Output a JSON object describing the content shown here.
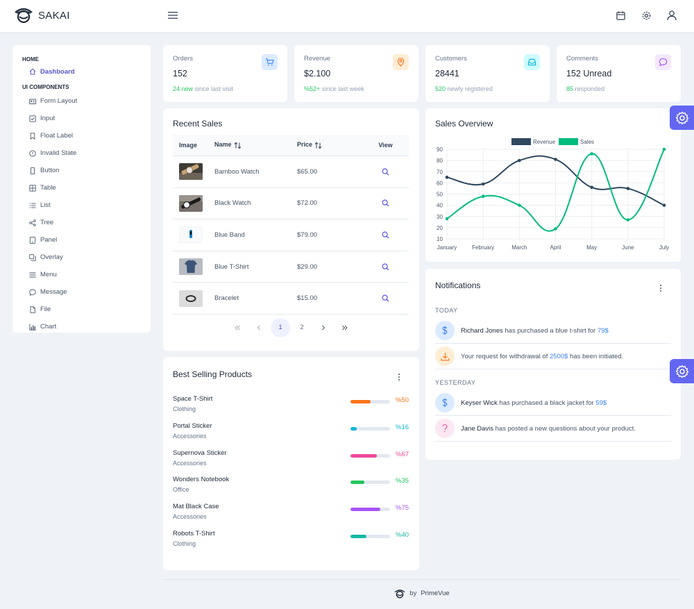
{
  "app": {
    "name": "SAKAI"
  },
  "sidebar": {
    "sections": [
      {
        "label": "HOME",
        "items": [
          {
            "label": "Dashboard",
            "icon": "home-icon",
            "active": true
          }
        ]
      },
      {
        "label": "UI COMPONENTS",
        "items": [
          {
            "label": "Form Layout",
            "icon": "id-card-icon"
          },
          {
            "label": "Input",
            "icon": "check-square-icon"
          },
          {
            "label": "Float Label",
            "icon": "bookmark-icon"
          },
          {
            "label": "Invalid State",
            "icon": "exclamation-circle-icon"
          },
          {
            "label": "Button",
            "icon": "mobile-icon"
          },
          {
            "label": "Table",
            "icon": "table-icon"
          },
          {
            "label": "List",
            "icon": "list-icon"
          },
          {
            "label": "Tree",
            "icon": "share-alt-icon"
          },
          {
            "label": "Panel",
            "icon": "tablet-icon"
          },
          {
            "label": "Overlay",
            "icon": "clone-icon"
          },
          {
            "label": "Menu",
            "icon": "bars-icon"
          },
          {
            "label": "Message",
            "icon": "comment-icon"
          },
          {
            "label": "File",
            "icon": "file-icon"
          },
          {
            "label": "Chart",
            "icon": "chart-bar-icon"
          }
        ]
      }
    ]
  },
  "stats": [
    {
      "label": "Orders",
      "value": "152",
      "highlight": "24 new",
      "rest": " since last visit",
      "icon": "shopping-cart-icon",
      "bg": "#dbeafe",
      "fg": "#3b82f6"
    },
    {
      "label": "Revenue",
      "value": "$2.100",
      "highlight": "%52+",
      "rest": " since last week",
      "icon": "map-marker-icon",
      "bg": "#ffedd5",
      "fg": "#f97316"
    },
    {
      "label": "Customers",
      "value": "28441",
      "highlight": "520",
      "rest": " newly registered",
      "icon": "inbox-icon",
      "bg": "#cffafe",
      "fg": "#06b6d4"
    },
    {
      "label": "Comments",
      "value": "152 Unread",
      "highlight": "85",
      "rest": " responded",
      "icon": "comment-icon",
      "bg": "#f3e8ff",
      "fg": "#a855f7"
    }
  ],
  "recent_sales": {
    "title": "Recent Sales",
    "columns": {
      "image": "Image",
      "name": "Name",
      "price": "Price",
      "view": "View"
    },
    "rows": [
      {
        "name": "Bamboo Watch",
        "price": "$65.00",
        "thumb": "bamboo-watch"
      },
      {
        "name": "Black Watch",
        "price": "$72.00",
        "thumb": "black-watch"
      },
      {
        "name": "Blue Band",
        "price": "$79.00",
        "thumb": "blue-band"
      },
      {
        "name": "Blue T-Shirt",
        "price": "$29.00",
        "thumb": "blue-t-shirt"
      },
      {
        "name": "Bracelet",
        "price": "$15.00",
        "thumb": "bracelet"
      }
    ],
    "pagination": {
      "pages": [
        "1",
        "2"
      ],
      "current": "1"
    }
  },
  "best_selling": {
    "title": "Best Selling Products",
    "items": [
      {
        "name": "Space T-Shirt",
        "category": "Clothing",
        "percent": 50,
        "label": "%50",
        "color": "#f97316"
      },
      {
        "name": "Portal Sticker",
        "category": "Accessories",
        "percent": 16,
        "label": "%16",
        "color": "#06b6d4"
      },
      {
        "name": "Supernova Sticker",
        "category": "Accessories",
        "percent": 67,
        "label": "%67",
        "color": "#ec4899"
      },
      {
        "name": "Wonders Notebook",
        "category": "Office",
        "percent": 35,
        "label": "%35",
        "color": "#22c55e"
      },
      {
        "name": "Mat Black Case",
        "category": "Accessories",
        "percent": 75,
        "label": "%75",
        "color": "#a855f7"
      },
      {
        "name": "Robots T-Shirt",
        "category": "Clothing",
        "percent": 40,
        "label": "%40",
        "color": "#14b8a6"
      }
    ]
  },
  "chart_data": {
    "type": "line",
    "title": "Sales Overview",
    "categories": [
      "January",
      "February",
      "March",
      "April",
      "May",
      "June",
      "July"
    ],
    "series": [
      {
        "name": "Revenue",
        "values": [
          65,
          59,
          80,
          81,
          56,
          55,
          40
        ],
        "color": "#2f4860"
      },
      {
        "name": "Sales",
        "values": [
          28,
          48,
          40,
          19,
          86,
          27,
          90
        ],
        "color": "#00bb7e"
      }
    ],
    "ylim": [
      10,
      90
    ],
    "yticks": [
      10,
      20,
      30,
      40,
      50,
      60,
      70,
      80,
      90
    ],
    "grid": true,
    "legend": "top-center",
    "xlabel": "",
    "ylabel": ""
  },
  "notifications": {
    "title": "Notifications",
    "groups": [
      {
        "label": "TODAY",
        "items": [
          {
            "who": "Richard Jones",
            "text": " has purchased a blue t-shirt for ",
            "amount": "79$",
            "tail": "",
            "icon": "dollar-icon",
            "bg": "#dbeafe",
            "fg": "#3b82f6"
          },
          {
            "who": "",
            "text": "Your request for withdrawal of ",
            "amount": "2500$",
            "tail": " has been initiated.",
            "icon": "download-icon",
            "bg": "#ffedd5",
            "fg": "#f97316"
          }
        ]
      },
      {
        "label": "YESTERDAY",
        "items": [
          {
            "who": "Keyser Wick",
            "text": " has purchased a black jacket for ",
            "amount": "59$",
            "tail": "",
            "icon": "dollar-icon",
            "bg": "#dbeafe",
            "fg": "#3b82f6"
          },
          {
            "who": "Jane Davis",
            "text": " has posted a new questions about your product.",
            "amount": "",
            "tail": "",
            "icon": "question-icon",
            "bg": "#fce7f3",
            "fg": "#ec4899"
          }
        ]
      }
    ]
  },
  "footer": {
    "by": "by",
    "brand": "PrimeVue"
  }
}
